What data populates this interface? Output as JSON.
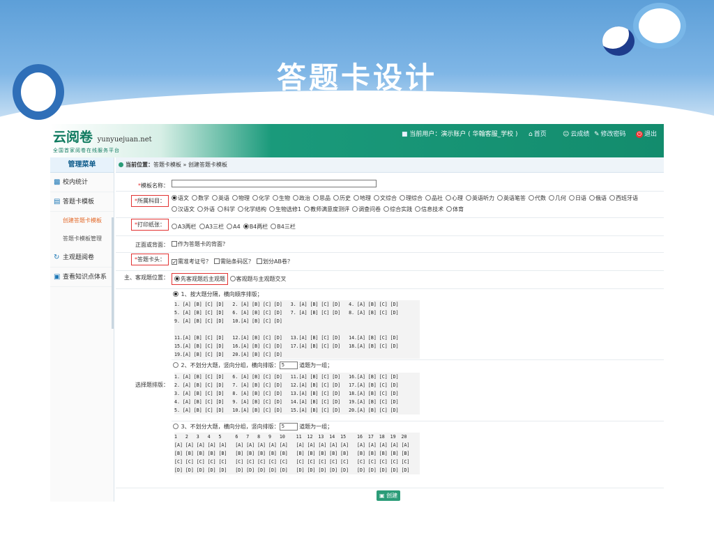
{
  "slide": {
    "title": "答题卡设计"
  },
  "header": {
    "logo_cn": "云阅卷",
    "logo_en": "yunyuejuan.net",
    "logo_sub": "全国首家阅卷在线服务平台",
    "user_info": "当前用户：演示账户 ( 华翰客服_学校 )",
    "links": [
      "首页",
      "云成绩",
      "修改密码",
      "退出"
    ]
  },
  "sidebar": {
    "title": "管理菜单",
    "items": [
      "校内统计",
      "答题卡模板",
      "创建答题卡模板",
      "答题卡模板管理",
      "主观题阅卷",
      "查看知识点体系"
    ]
  },
  "breadcrumb": {
    "label": "当前位置：",
    "path1": "答题卡模板",
    "sep": "»",
    "path2": "创建答题卡模板"
  },
  "form": {
    "name_label": "模板名称：",
    "subject_label": "所属科目：",
    "subjects": [
      "语文",
      "数学",
      "英语",
      "物理",
      "化学",
      "生物",
      "政治",
      "思品",
      "历史",
      "地理",
      "文综合",
      "理综合",
      "品社",
      "心理",
      "英语听力",
      "英语笔答",
      "代数",
      "几何",
      "日语",
      "俄语",
      "西班牙语",
      "汉语文",
      "外语",
      "科学",
      "化学结构",
      "生物选修1",
      "教师满意度测评",
      "调查问卷",
      "综合实践",
      "信息技术",
      "体育"
    ],
    "subject_selected": "语文",
    "paper_label": "打印纸张：",
    "papers": [
      "A3两栏",
      "A3三栏",
      "A4",
      "B4两栏",
      "B4三栏"
    ],
    "paper_selected": "B4两栏",
    "back_label": "正面或背面：",
    "back_option": "作为答题卡的背面？",
    "head_label": "答题卡头：",
    "head_options": [
      {
        "label": "需准考证号？",
        "checked": true
      },
      {
        "label": "需贴条码区？",
        "checked": false
      },
      {
        "label": "划分AB卷？",
        "checked": false
      }
    ],
    "position_label": "主、客观题位置：",
    "position_options": [
      "先客观题后主观题",
      "客观题与主观题交叉"
    ],
    "layout_label": "选择题排版：",
    "layout1": {
      "title": "1、按大题分隔，横向顺序排版；",
      "lines": [
        "1. [A] [B] [C] [D]   2. [A] [B] [C] [D]   3. [A] [B] [C] [D]   4. [A] [B] [C] [D]",
        "5. [A] [B] [C] [D]   6. [A] [B] [C] [D]   7. [A] [B] [C] [D]   8. [A] [B] [C] [D]",
        "9. [A] [B] [C] [D]   10.[A] [B] [C] [D]",
        "",
        "11.[A] [B] [C] [D]   12.[A] [B] [C] [D]   13.[A] [B] [C] [D]   14.[A] [B] [C] [D]",
        "15.[A] [B] [C] [D]   16.[A] [B] [C] [D]   17.[A] [B] [C] [D]   18.[A] [B] [C] [D]",
        "19.[A] [B] [C] [D]   20.[A] [B] [C] [D]"
      ]
    },
    "layout2": {
      "title_pre": "2、不划分大题，竖向分组，横向排版：",
      "group_size": "5",
      "title_post": "道题为一组；",
      "lines": [
        "1. [A] [B] [C] [D]   6. [A] [B] [C] [D]   11.[A] [B] [C] [D]   16.[A] [B] [C] [D]",
        "2. [A] [B] [C] [D]   7. [A] [B] [C] [D]   12.[A] [B] [C] [D]   17.[A] [B] [C] [D]",
        "3. [A] [B] [C] [D]   8. [A] [B] [C] [D]   13.[A] [B] [C] [D]   18.[A] [B] [C] [D]",
        "4. [A] [B] [C] [D]   9. [A] [B] [C] [D]   14.[A] [B] [C] [D]   19.[A] [B] [C] [D]",
        "5. [A] [B] [C] [D]   10.[A] [B] [C] [D]   15.[A] [B] [C] [D]   20.[A] [B] [C] [D]"
      ]
    },
    "layout3": {
      "title_pre": "3、不划分大题，横向分组，竖向排版：",
      "group_size": "5",
      "title_post": "道题为一组；",
      "lines": [
        "1   2   3   4   5     6   7   8   9   10    11  12  13  14  15    16  17  18  19  20",
        "[A] [A] [A] [A] [A]   [A] [A] [A] [A] [A]   [A] [A] [A] [A] [A]   [A] [A] [A] [A] [A]",
        "[B] [B] [B] [B] [B]   [B] [B] [B] [B] [B]   [B] [B] [B] [B] [B]   [B] [B] [B] [B] [B]",
        "[C] [C] [C] [C] [C]   [C] [C] [C] [C] [C]   [C] [C] [C] [C] [C]   [C] [C] [C] [C] [C]",
        "[D] [D] [D] [D] [D]   [D] [D] [D] [D] [D]   [D] [D] [D] [D] [D]   [D] [D] [D] [D] [D]"
      ]
    },
    "create_label": "创建"
  },
  "colors": {
    "accent": "#138c6d",
    "banner": "#5d9fd8",
    "required": "#e23232"
  }
}
